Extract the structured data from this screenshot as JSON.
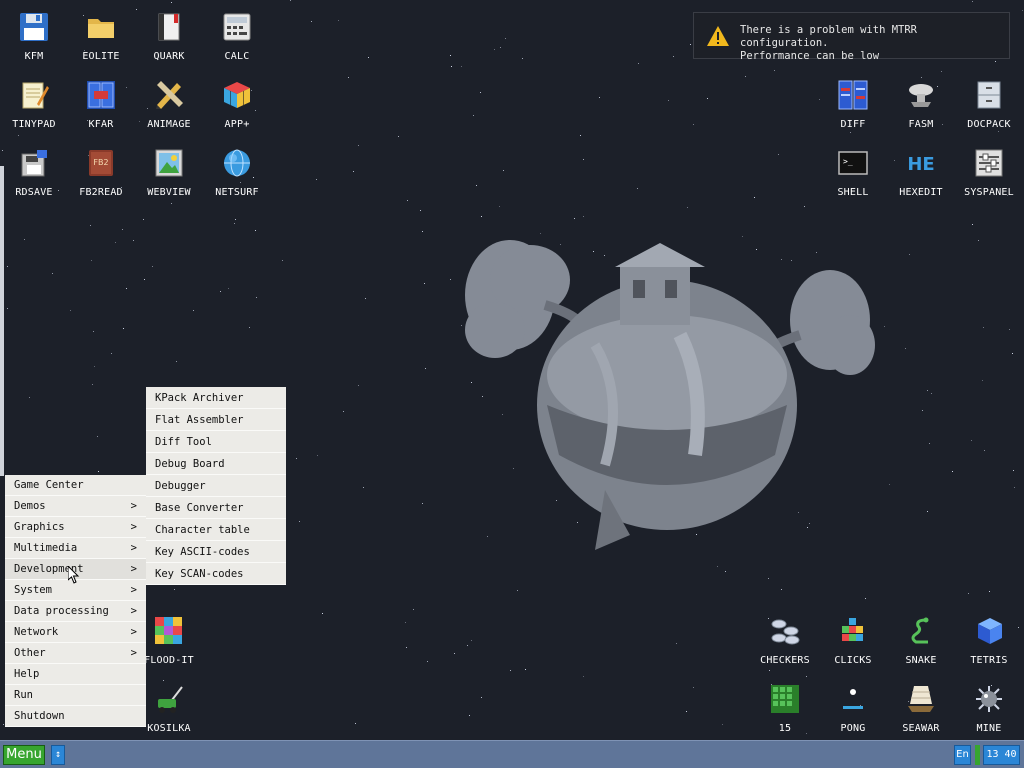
{
  "desktop": {
    "icons": [
      {
        "label": "KFM",
        "glyph": "floppy-icon"
      },
      {
        "label": "EOLITE",
        "glyph": "folder-icon"
      },
      {
        "label": "QUARK",
        "glyph": "notebook-icon"
      },
      {
        "label": "CALC",
        "glyph": "calculator-icon"
      },
      {
        "label": "TINYPAD",
        "glyph": "notepad-icon"
      },
      {
        "label": "KFAR",
        "glyph": "panels-icon"
      },
      {
        "label": "ANIMAGE",
        "glyph": "pencil-ruler-icon"
      },
      {
        "label": "APP+",
        "glyph": "cube-icon"
      },
      {
        "label": "RDSAVE",
        "glyph": "disk-save-icon"
      },
      {
        "label": "FB2READ",
        "glyph": "book-icon"
      },
      {
        "label": "WEBVIEW",
        "glyph": "picture-icon"
      },
      {
        "label": "NETSURF",
        "glyph": "globe-icon"
      },
      {
        "label": "DIFF",
        "glyph": "diff-icon"
      },
      {
        "label": "FASM",
        "glyph": "server-icon"
      },
      {
        "label": "DOCPACK",
        "glyph": "cabinet-icon"
      },
      {
        "label": "SHELL",
        "glyph": "terminal-icon"
      },
      {
        "label": "HEXEDIT",
        "glyph": "hex-icon"
      },
      {
        "label": "SYSPANEL",
        "glyph": "sliders-icon"
      },
      {
        "label": "FLOOD-IT",
        "glyph": "grid-colors-icon"
      },
      {
        "label": "KOSILKA",
        "glyph": "lawnmower-icon"
      },
      {
        "label": "CHECKERS",
        "glyph": "checkers-icon"
      },
      {
        "label": "CLICKS",
        "glyph": "blocks-icon"
      },
      {
        "label": "SNAKE",
        "glyph": "snake-icon"
      },
      {
        "label": "TETRIS",
        "glyph": "tetris-icon"
      },
      {
        "label": "15",
        "glyph": "fifteen-icon"
      },
      {
        "label": "PONG",
        "glyph": "pong-icon"
      },
      {
        "label": "SEAWAR",
        "glyph": "ship-icon"
      },
      {
        "label": "MINE",
        "glyph": "mine-icon"
      }
    ]
  },
  "notification": {
    "line1": "There is a problem with MTRR configuration.",
    "line2": "Performance can be low"
  },
  "main_menu": {
    "items": [
      {
        "label": "Game Center",
        "arrow": ""
      },
      {
        "label": "Demos",
        "arrow": ">"
      },
      {
        "label": "Graphics",
        "arrow": ">"
      },
      {
        "label": "Multimedia",
        "arrow": ">"
      },
      {
        "label": "Development",
        "arrow": ">"
      },
      {
        "label": "System",
        "arrow": ">"
      },
      {
        "label": "Data processing",
        "arrow": ">"
      },
      {
        "label": "Network",
        "arrow": ">"
      },
      {
        "label": "Other",
        "arrow": ">"
      },
      {
        "label": "Help",
        "arrow": ""
      },
      {
        "label": "Run",
        "arrow": ""
      },
      {
        "label": "Shutdown",
        "arrow": ""
      }
    ]
  },
  "dev_submenu": {
    "items": [
      {
        "label": "KPack Archiver"
      },
      {
        "label": "Flat Assembler"
      },
      {
        "label": "Diff Tool"
      },
      {
        "label": "Debug Board"
      },
      {
        "label": "Debugger"
      },
      {
        "label": "Base Converter"
      },
      {
        "label": "Character table"
      },
      {
        "label": "Key ASCII-codes"
      },
      {
        "label": "Key SCAN-codes"
      }
    ]
  },
  "taskbar": {
    "menu_label": "Menu",
    "switch_glyph": "↕",
    "lang": "En",
    "clock": "13 40"
  },
  "colors": {
    "desktop_bg": "#1c2029",
    "taskbar": "#5f7599",
    "menu_bg": "#ecebe7",
    "menu_button": "#37a52f",
    "tray_button": "#2b86d6"
  }
}
